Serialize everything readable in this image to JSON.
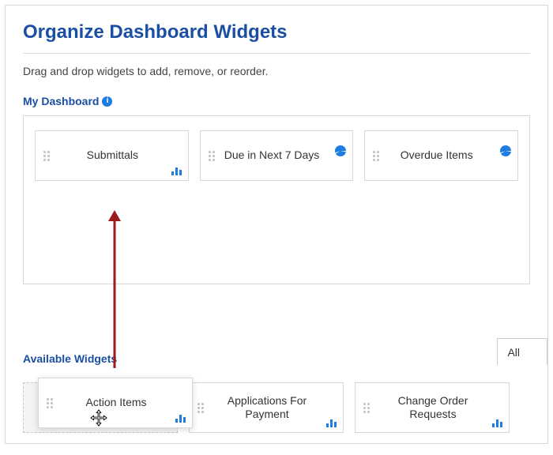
{
  "title": "Organize Dashboard Widgets",
  "instructions": "Drag and drop widgets to add, remove, or reorder.",
  "sections": {
    "myDashboard": {
      "label": "My Dashboard"
    },
    "available": {
      "label": "Available Widgets"
    }
  },
  "filter": {
    "selected": "All"
  },
  "dashboard_widgets": [
    {
      "name": "Submittals",
      "icon": "bars"
    },
    {
      "name": "Due in Next 7 Days",
      "icon": "pie"
    },
    {
      "name": "Overdue Items",
      "icon": "pie"
    }
  ],
  "available_widgets": [
    {
      "name": "Action Items",
      "icon": "bars",
      "dragging": true
    },
    {
      "name": "Applications For Payment",
      "icon": "bars"
    },
    {
      "name": "Change Order Requests",
      "icon": "bars"
    }
  ]
}
